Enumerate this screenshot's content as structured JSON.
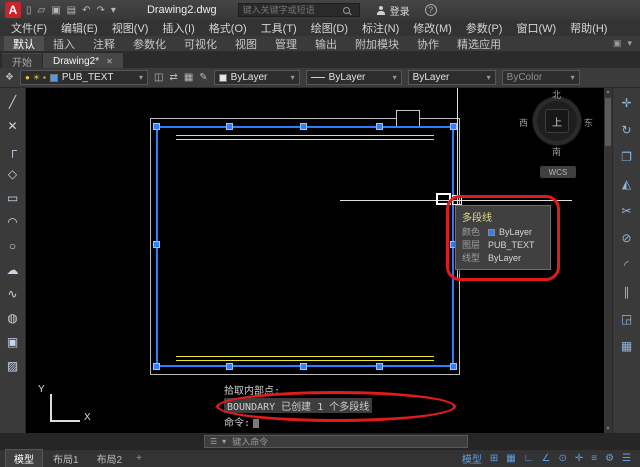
{
  "colors": {
    "canvas_bg": "#000000",
    "selection_blue": "#2d7dff",
    "grip_blue": "#2f7fff",
    "line_yellow": "#e8e832",
    "annotation_red": "#e01b1b",
    "panel_bg": "#3a3a3a",
    "status_icon_blue": "#5aa0e8",
    "logo_red": "#c8242c"
  },
  "title_bar": {
    "logo_letter": "A",
    "document_title": "Drawing2.dwg",
    "search_placeholder": "键入关键字或短语",
    "login_label": "登录",
    "help_glyph": "?",
    "quick_access_icons": [
      {
        "name": "new-file-icon",
        "glyph": "▯"
      },
      {
        "name": "open-file-icon",
        "glyph": "▱"
      },
      {
        "name": "save-icon",
        "glyph": "▣"
      },
      {
        "name": "print-icon",
        "glyph": "▤"
      },
      {
        "name": "undo-icon",
        "glyph": "↶"
      },
      {
        "name": "redo-icon",
        "glyph": "↷"
      },
      {
        "name": "qat-dropdown-icon",
        "glyph": "▾"
      }
    ]
  },
  "menu_bar": {
    "items": [
      "文件(F)",
      "编辑(E)",
      "视图(V)",
      "插入(I)",
      "格式(O)",
      "工具(T)",
      "绘图(D)",
      "标注(N)",
      "修改(M)",
      "参数(P)",
      "窗口(W)",
      "帮助(H)"
    ]
  },
  "ribbon": {
    "tabs": [
      {
        "label": "默认",
        "active": true
      },
      {
        "label": "插入"
      },
      {
        "label": "注释"
      },
      {
        "label": "参数化"
      },
      {
        "label": "可视化"
      },
      {
        "label": "视图"
      },
      {
        "label": "管理"
      },
      {
        "label": "输出"
      },
      {
        "label": "附加模块"
      },
      {
        "label": "协作"
      },
      {
        "label": "精选应用"
      }
    ],
    "right_icons": [
      {
        "name": "ribbon-state-icon",
        "glyph": "▣"
      },
      {
        "name": "ribbon-collapse-icon",
        "glyph": "▾"
      }
    ]
  },
  "file_tabs": {
    "tabs": [
      {
        "label": "开始"
      },
      {
        "label": "Drawing2*",
        "active": true
      }
    ],
    "close_glyph": "✕"
  },
  "properties_bar": {
    "layers_panel_icon": "❖",
    "layer_dropdown": {
      "value": "PUB_TEXT",
      "icons": [
        {
          "name": "layer-on-bulb-icon",
          "glyph": "●"
        },
        {
          "name": "layer-freeze-icon",
          "glyph": "☀"
        },
        {
          "name": "layer-lock-icon",
          "glyph": "▪"
        }
      ]
    },
    "mid_icons": [
      {
        "name": "layer-states-icon",
        "glyph": "◫"
      },
      {
        "name": "layer-match-icon",
        "glyph": "⇄"
      },
      {
        "name": "layer-isolate-icon",
        "glyph": "▦"
      },
      {
        "name": "make-current-icon",
        "glyph": "✎"
      }
    ],
    "color_value": "ByLayer",
    "linetype_value": "ByLayer",
    "lineweight_value": "ByLayer",
    "plot_style_value": "ByColor",
    "dropdown_arrow": "▾"
  },
  "left_toolbar": {
    "tools": [
      {
        "name": "line-tool-icon",
        "glyph": "╱"
      },
      {
        "name": "construction-line-tool-icon",
        "glyph": "✕"
      },
      {
        "name": "polyline-tool-icon",
        "glyph": "┌"
      },
      {
        "name": "polygon-tool-icon",
        "glyph": "◇"
      },
      {
        "name": "rectangle-tool-icon",
        "glyph": "▭"
      },
      {
        "name": "arc-tool-icon",
        "glyph": "◠"
      },
      {
        "name": "circle-tool-icon",
        "glyph": "○"
      },
      {
        "name": "revision-cloud-tool-icon",
        "glyph": "☁"
      },
      {
        "name": "spline-tool-icon",
        "glyph": "∿"
      },
      {
        "name": "ellipse-tool-icon",
        "glyph": "◍"
      },
      {
        "name": "insert-block-tool-icon",
        "glyph": "▣"
      },
      {
        "name": "hatch-tool-icon",
        "glyph": "▨"
      }
    ]
  },
  "right_toolbar": {
    "tools": [
      {
        "name": "move-tool-icon",
        "glyph": "✛"
      },
      {
        "name": "rotate-tool-icon",
        "glyph": "↻"
      },
      {
        "name": "copy-tool-icon",
        "glyph": "❐"
      },
      {
        "name": "mirror-tool-icon",
        "glyph": "◭"
      },
      {
        "name": "trim-tool-icon",
        "glyph": "✂"
      },
      {
        "name": "erase-tool-icon",
        "glyph": "⊘"
      },
      {
        "name": "fillet-tool-icon",
        "glyph": "◜"
      },
      {
        "name": "offset-tool-icon",
        "glyph": "∥"
      },
      {
        "name": "scale-tool-icon",
        "glyph": "◲"
      },
      {
        "name": "array-tool-icon",
        "glyph": "▦"
      }
    ]
  },
  "canvas": {
    "tooltip": {
      "title": "多段线",
      "rows": [
        {
          "label": "颜色",
          "value": "ByLayer"
        },
        {
          "label": "图层",
          "value": "PUB_TEXT"
        },
        {
          "label": "线型",
          "value": "ByLayer"
        }
      ]
    },
    "viewcube": {
      "north": "北",
      "south": "南",
      "east": "东",
      "west": "西",
      "top": "上",
      "wcs": "WCS"
    },
    "command_lines": [
      "拾取内部点:",
      "BOUNDARY 已创建 1 个多段线",
      "命令:"
    ],
    "ucs": {
      "x_label": "X",
      "y_label": "Y"
    }
  },
  "command_bar": {
    "placeholder": "键入命令",
    "icons": [
      {
        "name": "command-grip-icon",
        "glyph": "☰"
      },
      {
        "name": "command-customize-icon",
        "glyph": "▾"
      }
    ]
  },
  "status_bar": {
    "layout_tabs": [
      {
        "label": "模型",
        "active": true
      },
      {
        "label": "布局1"
      },
      {
        "label": "布局2"
      }
    ],
    "new_layout_glyph": "+",
    "icons": [
      {
        "name": "model-space-toggle",
        "glyph": "模型"
      },
      {
        "name": "grid-display-toggle",
        "glyph": "⊞"
      },
      {
        "name": "snap-mode-toggle",
        "glyph": "▦"
      },
      {
        "name": "ortho-mode-toggle",
        "glyph": "∟"
      },
      {
        "name": "polar-tracking-toggle",
        "glyph": "∠"
      },
      {
        "name": "object-snap-toggle",
        "glyph": "⊙"
      },
      {
        "name": "dynamic-input-toggle",
        "glyph": "✛"
      },
      {
        "name": "lineweight-display-toggle",
        "glyph": "≡"
      },
      {
        "name": "workspace-switching-menu",
        "glyph": "⚙"
      },
      {
        "name": "customize-menu",
        "glyph": "☰"
      }
    ]
  }
}
